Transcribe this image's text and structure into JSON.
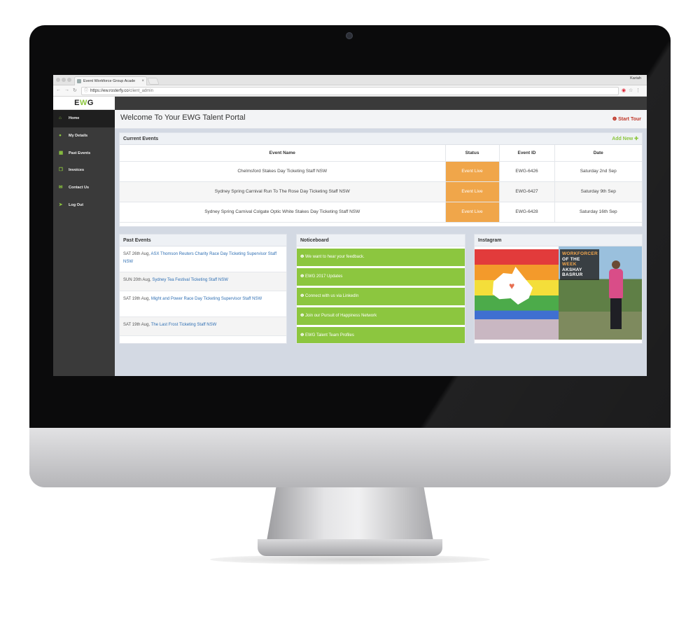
{
  "browser": {
    "tab_title": "Event Workforce Group Acade",
    "tab_close": "×",
    "user": "Kariah",
    "url_host": "https://ew.rosterfy.co",
    "url_path": "/client_admin"
  },
  "sidebar": {
    "logo": {
      "e": "E",
      "w": "W",
      "g": "G"
    },
    "items": [
      {
        "label": "Home",
        "icon": "home-icon"
      },
      {
        "label": "My Details",
        "icon": "user-icon"
      },
      {
        "label": "Past Events",
        "icon": "calendar-icon"
      },
      {
        "label": "Invoices",
        "icon": "documents-icon"
      },
      {
        "label": "Contact Us",
        "icon": "envelope-icon"
      },
      {
        "label": "Log Out",
        "icon": "arrow-icon"
      }
    ]
  },
  "header": {
    "title": "Welcome To Your EWG Talent Portal",
    "start_tour": "Start Tour"
  },
  "current_events": {
    "title": "Current Events",
    "add_new": "Add New",
    "columns": [
      "Event Name",
      "Status",
      "Event ID",
      "Date"
    ],
    "rows": [
      {
        "name": "Chelmsford Stakes Day Ticketing Staff NSW",
        "status": "Event Live",
        "id": "EWG-6426",
        "date": "Saturday 2nd Sep"
      },
      {
        "name": "Sydney Spring Carnival Run To The Rose Day Ticketing Staff NSW",
        "status": "Event Live",
        "id": "EWG-6427",
        "date": "Saturday 9th Sep"
      },
      {
        "name": "Sydney Spring Carnival Colgate Optic White Stakes Day Ticketing Staff NSW",
        "status": "Event Live",
        "id": "EWG-6428",
        "date": "Saturday 16th Sep"
      }
    ]
  },
  "past_events": {
    "title": "Past Events",
    "items": [
      {
        "date": "SAT 26th Aug,",
        "link": "ASX Thomson Reuters Charity Race Day Ticketing Supervisor Staff NSW"
      },
      {
        "date": "SUN 20th Aug,",
        "link": "Sydney Tea Festival Ticketing Staff NSW"
      },
      {
        "date": "SAT 19th Aug,",
        "link": "Might and Power Race Day Ticketing Supervisor Staff NSW"
      },
      {
        "date": "SAT 19th Aug,",
        "link": "The Last Frost Ticketing Staff NSW"
      }
    ]
  },
  "noticeboard": {
    "title": "Noticeboard",
    "items": [
      "We want to hear your feedback.",
      "EWG 2017 Updates",
      "Connect with us via LinkedIn",
      "Join our Pursuit of Happiness Network",
      "EWG Talent Team Profiles"
    ]
  },
  "instagram": {
    "title": "Instagram",
    "post_text": [
      "WORKFORCER",
      "OF THE",
      "WEEK",
      "AKSHAY",
      "BASRUR"
    ]
  },
  "colors": {
    "brand_green": "#8cc63f",
    "status_orange": "#f0a64a",
    "sidebar_dark": "#3a3a3a",
    "tour_red": "#c0392b",
    "link_blue": "#2f6fb3"
  }
}
